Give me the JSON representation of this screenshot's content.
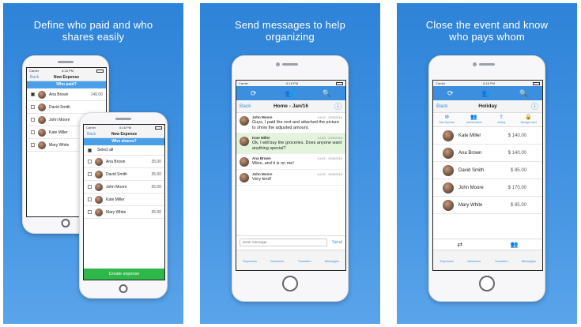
{
  "panels": [
    {
      "headline_1": "Define who paid and who",
      "headline_2": "shares easily"
    },
    {
      "headline_1": "Send messages to help",
      "headline_2": "organizing"
    },
    {
      "headline_1": "Close the event and know",
      "headline_2": "who pays whom"
    }
  ],
  "status": {
    "carrier": "Carrier",
    "time": "6:16 PM"
  },
  "expense_phone": {
    "back": "Back",
    "title": "New Expense",
    "band": "Who paid?",
    "rows": [
      {
        "name": "Ana Brown",
        "amount": "140.00",
        "checked": true
      },
      {
        "name": "David Smith",
        "amount": "",
        "checked": false
      },
      {
        "name": "John Moore",
        "amount": "",
        "checked": false
      },
      {
        "name": "Kate Miller",
        "amount": "",
        "checked": false
      },
      {
        "name": "Mary White",
        "amount": "",
        "checked": false
      }
    ]
  },
  "shares_phone": {
    "back": "Back",
    "title": "New Expense",
    "band": "Who shares?",
    "select_all": "Select all",
    "rows": [
      {
        "name": "Ana Brown",
        "amount": "35.00"
      },
      {
        "name": "David Smith",
        "amount": "35.00"
      },
      {
        "name": "John Moore",
        "amount": "35.00"
      },
      {
        "name": "Kate Miller",
        "amount": ""
      },
      {
        "name": "Mary White",
        "amount": "35.00"
      }
    ],
    "create_button": "Create expense"
  },
  "chat_phone": {
    "back": "Back",
    "title": "Home - Jan/16",
    "messages": [
      {
        "who": "John Moore",
        "time": "14:42 - 2/26/2016",
        "text": "Guys, I paid the rent and attached the picture to show the adjusted amount.",
        "highlight": false
      },
      {
        "who": "Kate Miller",
        "time": "14:43 - 2/26/2016",
        "text": "Ok, I will buy the groceries. Does anyone want anything special?",
        "highlight": true
      },
      {
        "who": "Ana Brown",
        "time": "14:43 - 2/26/2016",
        "text": "Wine, and it is on me!",
        "highlight": false
      },
      {
        "who": "John Moore",
        "time": "14:43 - 2/26/2016",
        "text": "Very kind!",
        "highlight": false
      }
    ],
    "input_placeholder": "Enter message...",
    "send": "Send",
    "tabs": [
      "Expenses",
      "Members",
      "Transfers",
      "Messages"
    ]
  },
  "holiday_phone": {
    "back": "Back",
    "title": "Holiday",
    "actions": [
      "New Expense",
      "Add Members",
      "Activity",
      "Manage event"
    ],
    "rows": [
      {
        "name": "Kate Miller",
        "amount": "$ 140.00",
        "positive": true
      },
      {
        "name": "Ana Brown",
        "amount": "$ 140.00",
        "positive": true
      },
      {
        "name": "David Smith",
        "amount": "$ 85.00",
        "positive": false
      },
      {
        "name": "John Moore",
        "amount": "$ 170.00",
        "positive": true
      },
      {
        "name": "Mary White",
        "amount": "$ 85.00",
        "positive": false
      }
    ],
    "tabs": [
      "Expenses",
      "Members",
      "Transfers",
      "Messages"
    ]
  },
  "icons": [
    "refresh-icon",
    "people-icon",
    "search-icon",
    "info-icon",
    "camera-icon",
    "trash-icon"
  ],
  "colors": {
    "accent": "#3b8fde",
    "panel": "#3d8fe0",
    "positive": "#3aa63a",
    "negative": "#e04848",
    "button": "#2fb84a"
  }
}
